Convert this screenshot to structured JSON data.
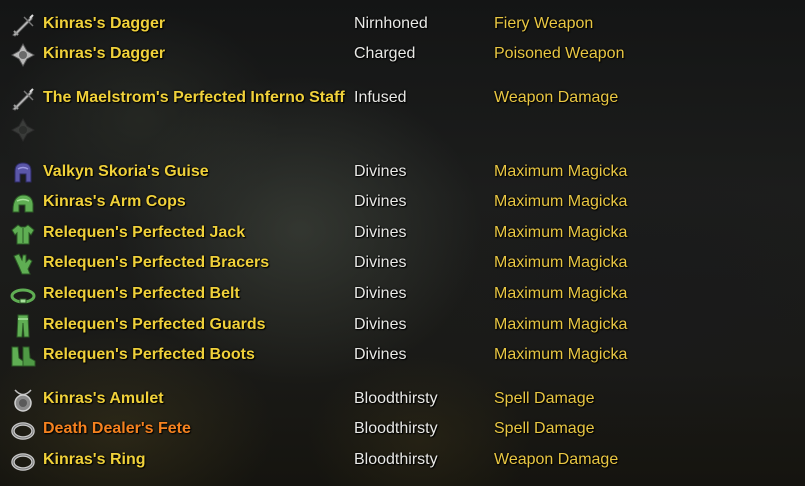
{
  "colors": {
    "legendary_name": "#f0d13a",
    "artifact_name": "#f5821f",
    "trait_text": "#e9e9e6",
    "enchant_text": "#e9c743"
  },
  "rows": [
    {
      "icon": "dagger-icon",
      "name": "Kinras's Dagger",
      "trait": "Nirnhoned",
      "enchant": "Fiery Weapon"
    },
    {
      "icon": "offhand-slot-icon",
      "name": "Kinras's Dagger",
      "trait": "Charged",
      "enchant": "Poisoned Weapon"
    },
    {
      "icon": "staff-icon",
      "name": "The Maelstrom's Perfected Inferno Staff",
      "trait": "Infused",
      "enchant": "Weapon Damage"
    },
    {
      "icon": "empty-offhand-slot-icon",
      "name": "",
      "trait": "",
      "enchant": ""
    },
    {
      "icon": "helmet-icon",
      "name": "Valkyn Skoria's Guise",
      "trait": "Divines",
      "enchant": "Maximum Magicka"
    },
    {
      "icon": "shoulder-icon",
      "name": "Kinras's Arm Cops",
      "trait": "Divines",
      "enchant": "Maximum Magicka"
    },
    {
      "icon": "chest-icon",
      "name": "Relequen's Perfected Jack",
      "trait": "Divines",
      "enchant": "Maximum Magicka"
    },
    {
      "icon": "gloves-icon",
      "name": "Relequen's Perfected Bracers",
      "trait": "Divines",
      "enchant": "Maximum Magicka"
    },
    {
      "icon": "belt-icon",
      "name": "Relequen's Perfected Belt",
      "trait": "Divines",
      "enchant": "Maximum Magicka"
    },
    {
      "icon": "legs-icon",
      "name": "Relequen's Perfected Guards",
      "trait": "Divines",
      "enchant": "Maximum Magicka"
    },
    {
      "icon": "boots-icon",
      "name": "Relequen's Perfected Boots",
      "trait": "Divines",
      "enchant": "Maximum Magicka"
    },
    {
      "icon": "amulet-icon",
      "name": "Kinras's Amulet",
      "trait": "Bloodthirsty",
      "enchant": "Spell Damage"
    },
    {
      "icon": "ring-icon",
      "name": "Death Dealer's Fete",
      "trait": "Bloodthirsty",
      "enchant": "Spell Damage"
    },
    {
      "icon": "ring-icon",
      "name": "Kinras's Ring",
      "trait": "Bloodthirsty",
      "enchant": "Weapon Damage"
    }
  ]
}
